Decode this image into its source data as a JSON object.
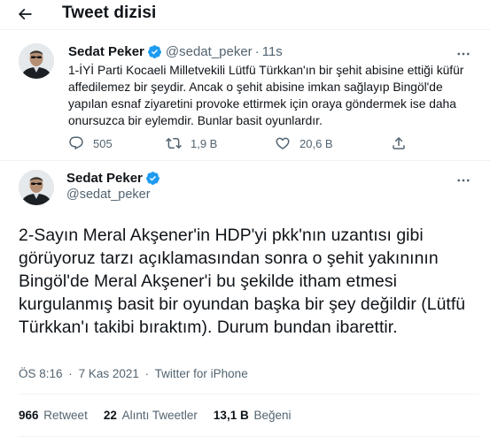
{
  "header": {
    "title": "Tweet dizisi"
  },
  "tweet1": {
    "author_name": "Sedat Peker",
    "handle": "@sedat_peker",
    "separator": "·",
    "time": "11s",
    "text": "1-İYİ Parti Kocaeli Milletvekili Lütfü Türkkan'ın bir şehit abisine ettiği küfür affedilemez bir şeydir. Ancak o şehit abisine imkan sağlayıp Bingöl'de yapılan esnaf ziyaretini provoke ettirmek için oraya göndermek ise daha onursuzca bir eylemdir. Bunlar basit oyunlardır.",
    "replies": "505",
    "retweets": "1,9 B",
    "likes": "20,6 B"
  },
  "tweet2": {
    "author_name": "Sedat Peker",
    "handle": "@sedat_peker",
    "text": "2-Sayın Meral Akşener'in HDP'yi pkk'nın uzantısı gibi görüyoruz tarzı açıklamasından sonra o şehit yakınının Bingöl'de Meral Akşener'i bu şekilde itham etmesi kurgulanmış basit bir oyundan başka bir şey değildir (Lütfü Türkkan'ı takibi bıraktım). Durum bundan ibarettir.",
    "time": "ÖS 8:16",
    "separator": "·",
    "date": "7 Kas 2021",
    "source": "Twitter for iPhone",
    "retweet_count": "966",
    "retweet_label": "Retweet",
    "quote_count": "22",
    "quote_label": "Alıntı Tweetler",
    "like_count": "13,1 B",
    "like_label": "Beğeni"
  },
  "icons": {
    "back": "arrow-left-icon",
    "more": "more-dots-icon",
    "verified": "verified-badge-icon",
    "reply": "reply-icon",
    "retweet": "retweet-icon",
    "like": "heart-icon",
    "share": "share-icon"
  },
  "colors": {
    "accent": "#1d9bf0",
    "text": "#0f1419",
    "secondary": "#536471",
    "divider": "#eff3f4"
  }
}
